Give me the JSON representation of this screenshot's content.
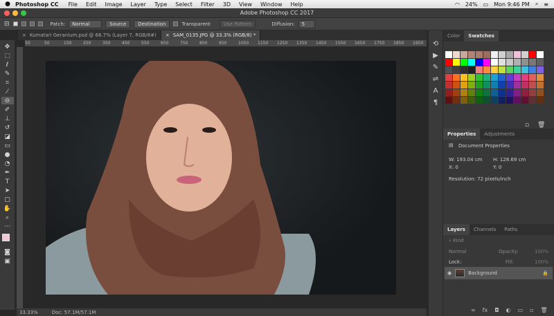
{
  "menubar": {
    "app_name": "Photoshop CC",
    "items": [
      "File",
      "Edit",
      "Image",
      "Layer",
      "Type",
      "Select",
      "Filter",
      "3D",
      "View",
      "Window",
      "Help"
    ],
    "battery": "24%",
    "time": "Mon 9:46 PM"
  },
  "window": {
    "title": "Adobe Photoshop CC 2017"
  },
  "options": {
    "patch_label": "Patch:",
    "patch_value": "Normal",
    "source_label": "Source",
    "destination_label": "Destination",
    "transparent_label": "Transparent",
    "use_pattern_label": "Use Pattern",
    "diffusion_label": "Diffusion:",
    "diffusion_value": "5"
  },
  "tabs": [
    {
      "label": "Kumatari Geranium.psd @ 66.7% (Layer 7, RGB/8#)"
    },
    {
      "label": "SAM_0135.JPG @ 33.3% (RGB/8) *"
    }
  ],
  "ruler": {
    "ticks": [
      "50",
      "0",
      "50",
      "100",
      "150",
      "200",
      "250",
      "300",
      "350",
      "400",
      "450",
      "500",
      "550",
      "600",
      "650",
      "700",
      "750",
      "800",
      "850",
      "900",
      "950",
      "1000",
      "1050",
      "1100",
      "1150",
      "1200",
      "1250",
      "1300",
      "1350",
      "1400",
      "1450",
      "1500",
      "1550",
      "1600",
      "1650",
      "1700",
      "1750",
      "1800",
      "1850",
      "1900",
      "1950",
      "2000"
    ]
  },
  "status": {
    "zoom": "33.33%",
    "doc": "Doc: 57.1M/57.1M"
  },
  "color_panel": {
    "tabs": [
      "Color",
      "Swatches"
    ]
  },
  "properties": {
    "tabs": [
      "Properties",
      "Adjustments"
    ],
    "section": "Document Properties",
    "w": "W: 193.04 cm",
    "h": "H: 128.69 cm",
    "x": "X: 0",
    "y": "Y: 0",
    "resolution": "Resolution: 72 pixels/inch"
  },
  "layers": {
    "tabs": [
      "Layers",
      "Channels",
      "Paths"
    ],
    "kind_label": "Kind",
    "blend_mode": "Normal",
    "opacity_label": "Opacity:",
    "opacity_value": "100%",
    "lock_label": "Lock:",
    "fill_label": "Fill:",
    "fill_value": "100%",
    "layer_name": "Background"
  },
  "colors": {
    "swatches": [
      "#ffffff",
      "#f2d9d0",
      "#c8a89b",
      "#b38475",
      "#a77c6c",
      "#9a6d5e",
      "#f0f0f0",
      "#d0d0d0",
      "#a8a8a8",
      "#f0c0d8",
      "#d0d0d0",
      "#ff0000",
      "#ffffff",
      "#ff0000",
      "#ffff00",
      "#00ff00",
      "#00ffff",
      "#0000ff",
      "#ff00ff",
      "#ffffff",
      "#e0e0e0",
      "#c8c8c8",
      "#b0b0b0",
      "#909090",
      "#787878",
      "#606060",
      "#505050",
      "#404040",
      "#303030",
      "#202020",
      "#f08080",
      "#ff8c40",
      "#ffd040",
      "#c0e040",
      "#60d060",
      "#40d0a0",
      "#40c0e0",
      "#4080e0",
      "#8060e0",
      "#e04040",
      "#ff7020",
      "#ffc020",
      "#a0d020",
      "#30c030",
      "#20b080",
      "#20a0d0",
      "#2060d0",
      "#6040d0",
      "#c040c0",
      "#e04080",
      "#e06060",
      "#e09040",
      "#c03030",
      "#d05010",
      "#e0a010",
      "#80b010",
      "#20a020",
      "#109060",
      "#1080b0",
      "#1040b0",
      "#4030b0",
      "#a030a0",
      "#c03060",
      "#c05050",
      "#c07030",
      "#902020",
      "#a04010",
      "#b08010",
      "#608010",
      "#108010",
      "#107040",
      "#106090",
      "#103090",
      "#302090",
      "#802080",
      "#902040",
      "#904040",
      "#905020",
      "#601010",
      "#703010",
      "#806010",
      "#406010",
      "#106010",
      "#105030",
      "#104060",
      "#102060",
      "#201060",
      "#601060",
      "#601030",
      "#603030",
      "#603010"
    ]
  }
}
